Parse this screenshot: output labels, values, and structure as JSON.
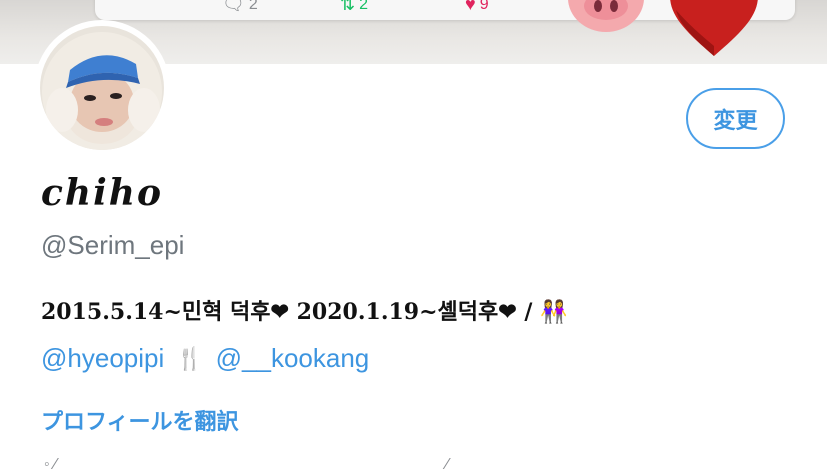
{
  "banner": {
    "reply_count": "2",
    "retweet_count": "2",
    "like_count": "9",
    "reply_icon": "reply-icon",
    "retweet_icon": "retweet-icon",
    "like_icon": "heart-icon",
    "decorations": [
      "pig-emoji",
      "red-heart-emoji"
    ]
  },
  "profile": {
    "edit_button_label": "変更",
    "display_name": "chiho",
    "handle": "@Serim_epi",
    "bio_line1": "2015.5.14~민혁 덕후❤ 2020.1.19~셸덕후❤ / 👭",
    "mention1": "@hyeopipi",
    "separator_icon": "🍴",
    "mention2": "@__kookang",
    "translate_label": "プロフィールを翻訳"
  },
  "colors": {
    "link": "#3d95e0",
    "text": "#111111",
    "muted": "#6e767d",
    "button_border": "#4a9fe8"
  }
}
